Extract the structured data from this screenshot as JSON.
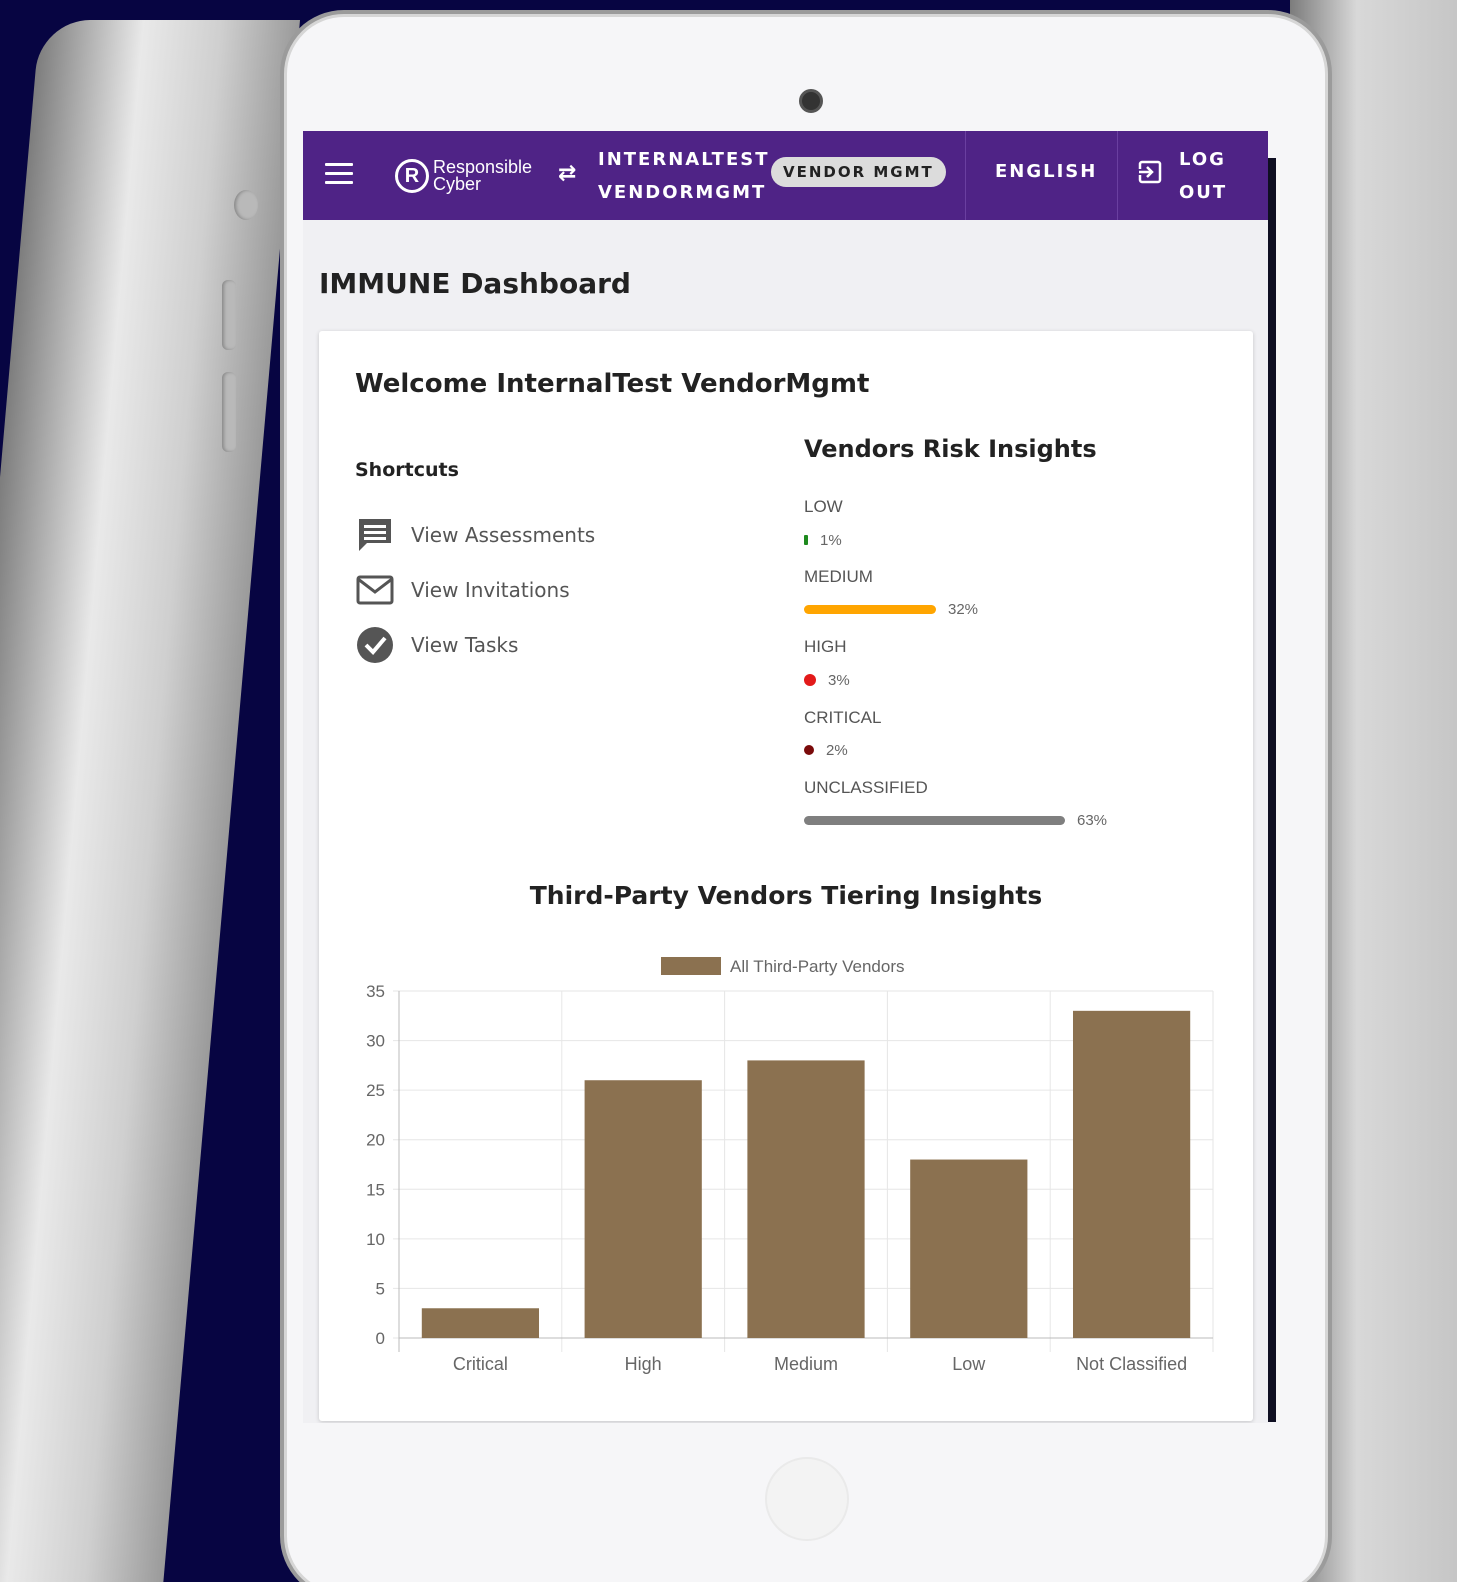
{
  "topbar": {
    "logo_mark": "R",
    "logo_line1": "Responsible",
    "logo_line2": "Cyber",
    "user_line1": "INTERNALTEST",
    "user_line2": "VENDORMGMT",
    "role_badge": "VENDOR MGMT",
    "language": "ENGLISH",
    "logout_line1": "LOG",
    "logout_line2": "OUT"
  },
  "page": {
    "title": "IMMUNE Dashboard",
    "welcome": "Welcome InternalTest VendorMgmt"
  },
  "shortcuts": {
    "title": "Shortcuts",
    "items": [
      {
        "label": "View Assessments",
        "icon": "comment-icon"
      },
      {
        "label": "View Invitations",
        "icon": "mail-icon"
      },
      {
        "label": "View Tasks",
        "icon": "check-circle-icon"
      }
    ]
  },
  "risk_insights": {
    "title": "Vendors Risk Insights",
    "items": [
      {
        "label": "LOW",
        "percent_text": "1%",
        "value": 1,
        "color": "#1e8a1e"
      },
      {
        "label": "MEDIUM",
        "percent_text": "32%",
        "value": 32,
        "color": "#ffa500"
      },
      {
        "label": "HIGH",
        "percent_text": "3%",
        "value": 3,
        "color": "#e31a1a"
      },
      {
        "label": "CRITICAL",
        "percent_text": "2%",
        "value": 2,
        "color": "#7a0a0a"
      },
      {
        "label": "UNCLASSIFIED",
        "percent_text": "63%",
        "value": 63,
        "color": "#7f7f7f"
      }
    ]
  },
  "chart_data": {
    "type": "bar",
    "title": "Third-Party Vendors Tiering Insights",
    "categories": [
      "Critical",
      "High",
      "Medium",
      "Low",
      "Not Classified"
    ],
    "series": [
      {
        "name": "All Third-Party Vendors",
        "values": [
          3,
          26,
          28,
          18,
          33
        ],
        "color": "#8b7150"
      }
    ],
    "ylim": [
      0,
      35
    ],
    "yticks": [
      "0",
      "5",
      "10",
      "15",
      "20",
      "25",
      "30",
      "35"
    ],
    "grid": true,
    "legend": "top-center"
  }
}
